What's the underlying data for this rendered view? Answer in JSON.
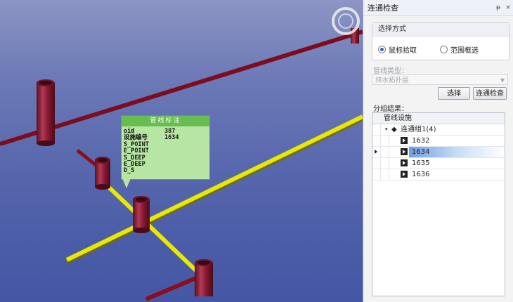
{
  "panel": {
    "title": "连通检查",
    "pin_glyph": "ᵽ",
    "close_glyph": "×",
    "selection_group_title": "选择方式",
    "radio_mouse_label": "鼠标拾取",
    "radio_range_label": "范围框选",
    "radio_mouse_selected": true,
    "pipe_type_label": "管线类型：",
    "pipe_type_value": "排水拓扑层",
    "select_button_label": "选择",
    "check_button_label": "连通检查",
    "result_label": "分组结果：",
    "tree_header": "管线设施",
    "group_label": "连通组1(4)",
    "items": [
      "1632",
      "1634",
      "1635",
      "1636"
    ],
    "selected_item": "1634"
  },
  "popup": {
    "title": "管线标注",
    "rows": [
      {
        "key": "oid",
        "value": "387"
      },
      {
        "key": "设施编号",
        "value": "1634"
      },
      {
        "key": "S_POINT",
        "value": ""
      },
      {
        "key": "E_POINT",
        "value": ""
      },
      {
        "key": "S_DEEP",
        "value": ""
      },
      {
        "key": "E_DEEP",
        "value": ""
      },
      {
        "key": "D_S",
        "value": ""
      }
    ]
  },
  "colors": {
    "yellow_pipe": "#e8e800",
    "red_pipe": "#8a0e1e",
    "manhole": "#8c1a33",
    "selection": "#6f9ee6"
  }
}
